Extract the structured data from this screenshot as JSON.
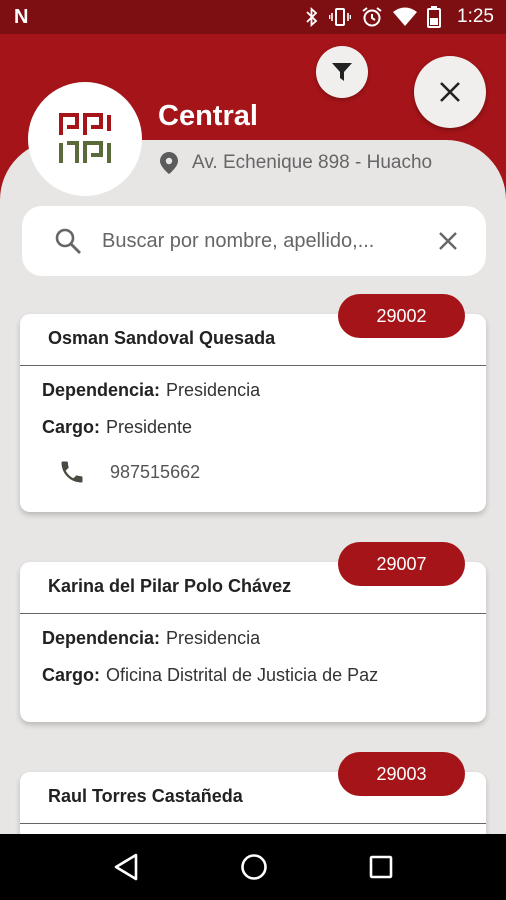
{
  "status_bar": {
    "carrier_glyph": "N",
    "time": "1:25",
    "icons": [
      "bluetooth-icon",
      "vibrate-icon",
      "alarm-icon",
      "wifi-icon",
      "battery-icon"
    ]
  },
  "header": {
    "title": "Central",
    "address": "Av. Echenique 898 - Huacho"
  },
  "search": {
    "placeholder": "Buscar por nombre, apellido,..."
  },
  "labels": {
    "dependencia": "Dependencia:",
    "cargo": "Cargo:"
  },
  "contacts": [
    {
      "id": "29002",
      "name": "Osman Sandoval Quesada",
      "dependencia": "Presidencia",
      "cargo": "Presidente",
      "phone": "987515662"
    },
    {
      "id": "29007",
      "name": "Karina del Pilar Polo Chávez",
      "dependencia": "Presidencia",
      "cargo": "Oficina Distrital de Justicia de Paz"
    },
    {
      "id": "29003",
      "name": "Raul Torres Castañeda"
    }
  ],
  "colors": {
    "brand_red": "#a51418",
    "status_bar": "#7d0f12",
    "logo_red": "#a51418",
    "logo_green": "#5a6b3a"
  }
}
